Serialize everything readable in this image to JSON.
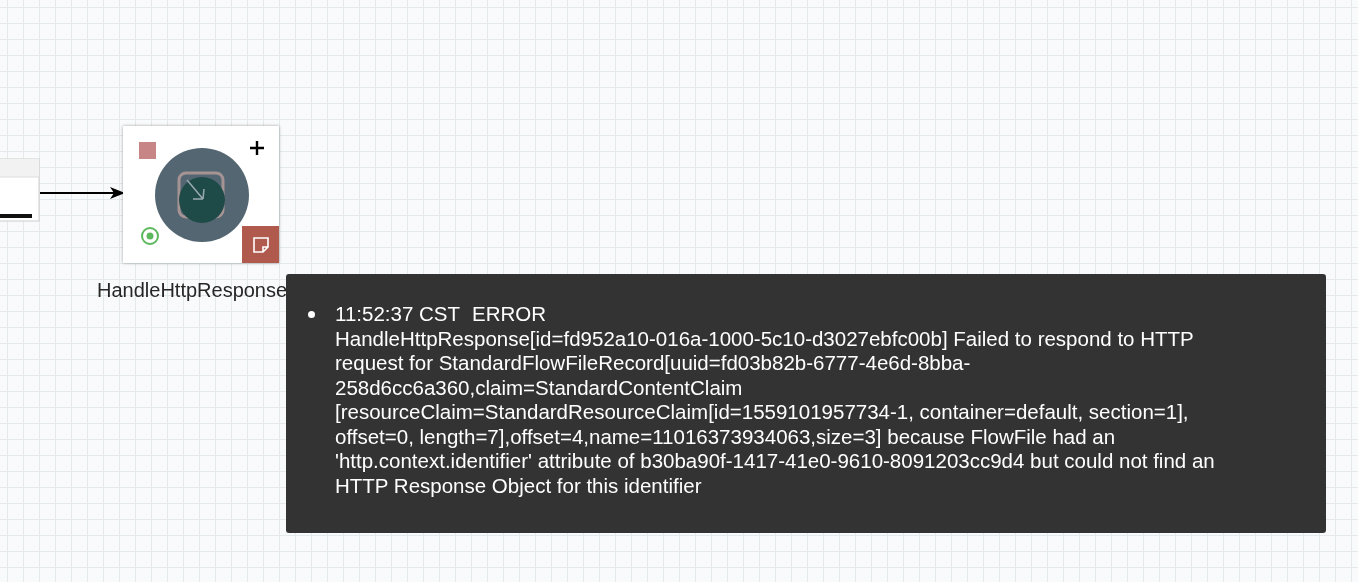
{
  "canvas": {
    "processor": {
      "name": "HandleHttpResponse",
      "stopped": true,
      "has_bulletins": true
    }
  },
  "bulletin_tooltip": {
    "bulletins": [
      {
        "time": "11:52:37 CST",
        "severity": "ERROR",
        "message": "HandleHttpResponse[id=fd952a10-016a-1000-5c10-d3027ebfc00b] Failed to respond to HTTP request for StandardFlowFileRecord[uuid=fd03b82b-6777-4e6d-8bba-258d6cc6a360,claim=StandardContentClaim [resourceClaim=StandardResourceClaim[id=1559101957734-1, container=default, section=1], offset=0, length=7],offset=4,name=11016373934063,size=3] because FlowFile had an 'http.context.identifier' attribute of b30ba90f-1417-41e0-9610-8091203cc9d4 but could not find an HTTP Response Object for this identifier"
      }
    ]
  }
}
